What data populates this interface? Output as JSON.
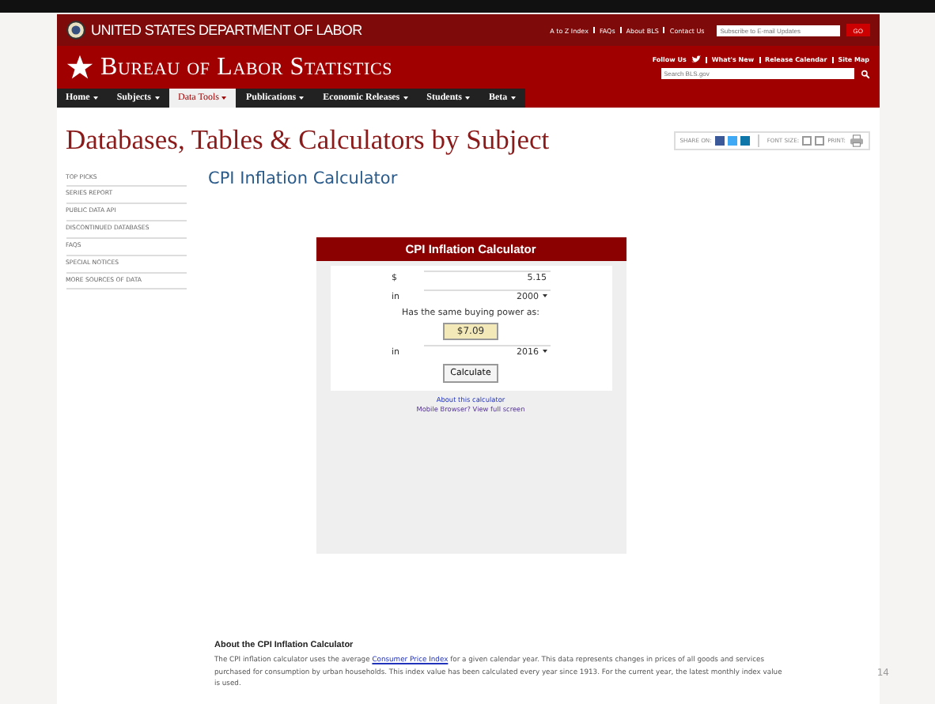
{
  "header": {
    "agency": "UNITED STATES DEPARTMENT OF LABOR",
    "top_links": [
      "A to Z Index",
      "FAQs",
      "About BLS",
      "Contact Us"
    ],
    "subscribe": {
      "placeholder": "Subscribe to E-mail Updates"
    },
    "go": "GO",
    "title": "Bureau of Labor Statistics",
    "follow": "Follow Us",
    "secondary_links": [
      "What's New",
      "Release Calendar",
      "Site Map"
    ],
    "search": {
      "placeholder": "Search BLS.gov"
    }
  },
  "nav": [
    {
      "label": "Home",
      "selected": false
    },
    {
      "label": "Subjects",
      "selected": false
    },
    {
      "label": "Data Tools",
      "selected": true
    },
    {
      "label": "Publications",
      "selected": false
    },
    {
      "label": "Economic Releases",
      "selected": false
    },
    {
      "label": "Students",
      "selected": false
    },
    {
      "label": "Beta",
      "selected": false
    }
  ],
  "page_title": "Databases, Tables & Calculators by Subject",
  "share_label": "SHARE ON:",
  "font_size_label": "FONT SIZE:",
  "print_label": "PRINT:",
  "sidebar": [
    "TOP PICKS",
    "SERIES REPORT",
    "PUBLIC DATA API",
    "DISCONTINUED DATABASES",
    "FAQS",
    "SPECIAL NOTICES",
    "MORE SOURCES OF DATA"
  ],
  "calc_heading": "CPI Inflation Calculator",
  "calculator": {
    "title": "CPI Inflation Calculator",
    "currency": "$",
    "amount": "5.15",
    "in_label_1": "in",
    "year_1": "2000",
    "same_power": "Has the same buying power as:",
    "result": "$7.09",
    "in_label_2": "in",
    "year_2": "2016",
    "button": "Calculate",
    "about_link": "About this calculator",
    "mobile_link": "Mobile Browser? View full screen"
  },
  "about": {
    "heading": "About the CPI Inflation Calculator",
    "text_before": "The CPI inflation calculator uses the average",
    "link": "Consumer Price Index",
    "text_after": "for a given calendar year. This data represents changes in prices of all goods and services purchased for consumption by urban households. This index value has been calculated every year since 1913. For the current year, the latest monthly index value is used."
  },
  "slide_number": "14"
}
